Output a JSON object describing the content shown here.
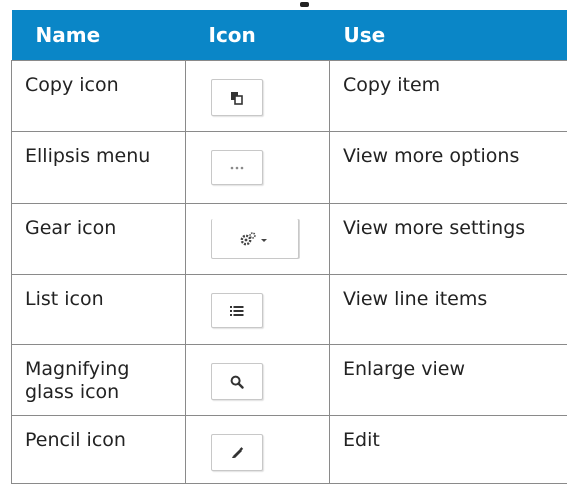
{
  "table": {
    "headers": {
      "name": "Name",
      "icon": "Icon",
      "use": "Use"
    },
    "header_color": "#0a86c7",
    "rows": [
      {
        "name": "Copy icon",
        "icon": "copy-icon",
        "use": "Copy item"
      },
      {
        "name": "Ellipsis menu",
        "icon": "ellipsis-icon",
        "use": "View more options"
      },
      {
        "name": "Gear icon",
        "icon": "gear-icon",
        "use": "View more settings"
      },
      {
        "name": "List icon",
        "icon": "list-icon",
        "use": "View line items"
      },
      {
        "name": "Magnifying glass icon",
        "icon": "magnifying-glass-icon",
        "use": "Enlarge view"
      },
      {
        "name": "Pencil icon",
        "icon": "pencil-icon",
        "use": "Edit"
      }
    ]
  }
}
